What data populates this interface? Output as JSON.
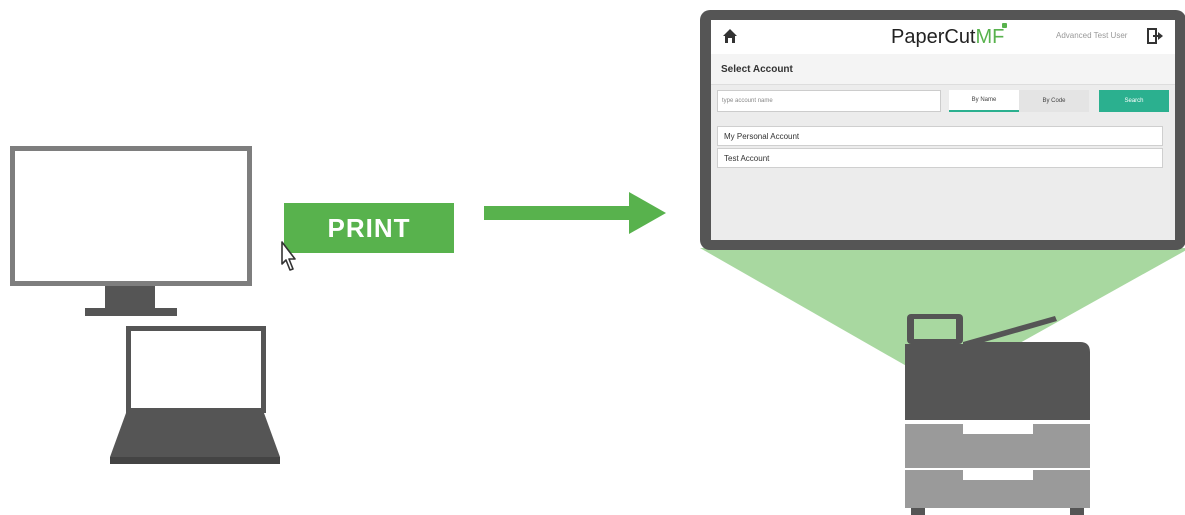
{
  "print_button": {
    "label": "PRINT"
  },
  "screen": {
    "brand_primary": "PaperCut",
    "brand_accent": "MF",
    "user_name": "Advanced Test User",
    "title": "Select Account",
    "search_placeholder": "type account name",
    "tab_by_name": "By Name",
    "tab_by_code": "By Code",
    "search_button": "Search",
    "accounts": [
      "My Personal Account",
      "Test Account"
    ],
    "icons": [
      "home-icon",
      "logout-icon"
    ]
  },
  "colors": {
    "green": "#58b24d",
    "teal": "#2bb08f",
    "light_green_beam": "#a8d8a0",
    "dark_gray": "#555555"
  }
}
